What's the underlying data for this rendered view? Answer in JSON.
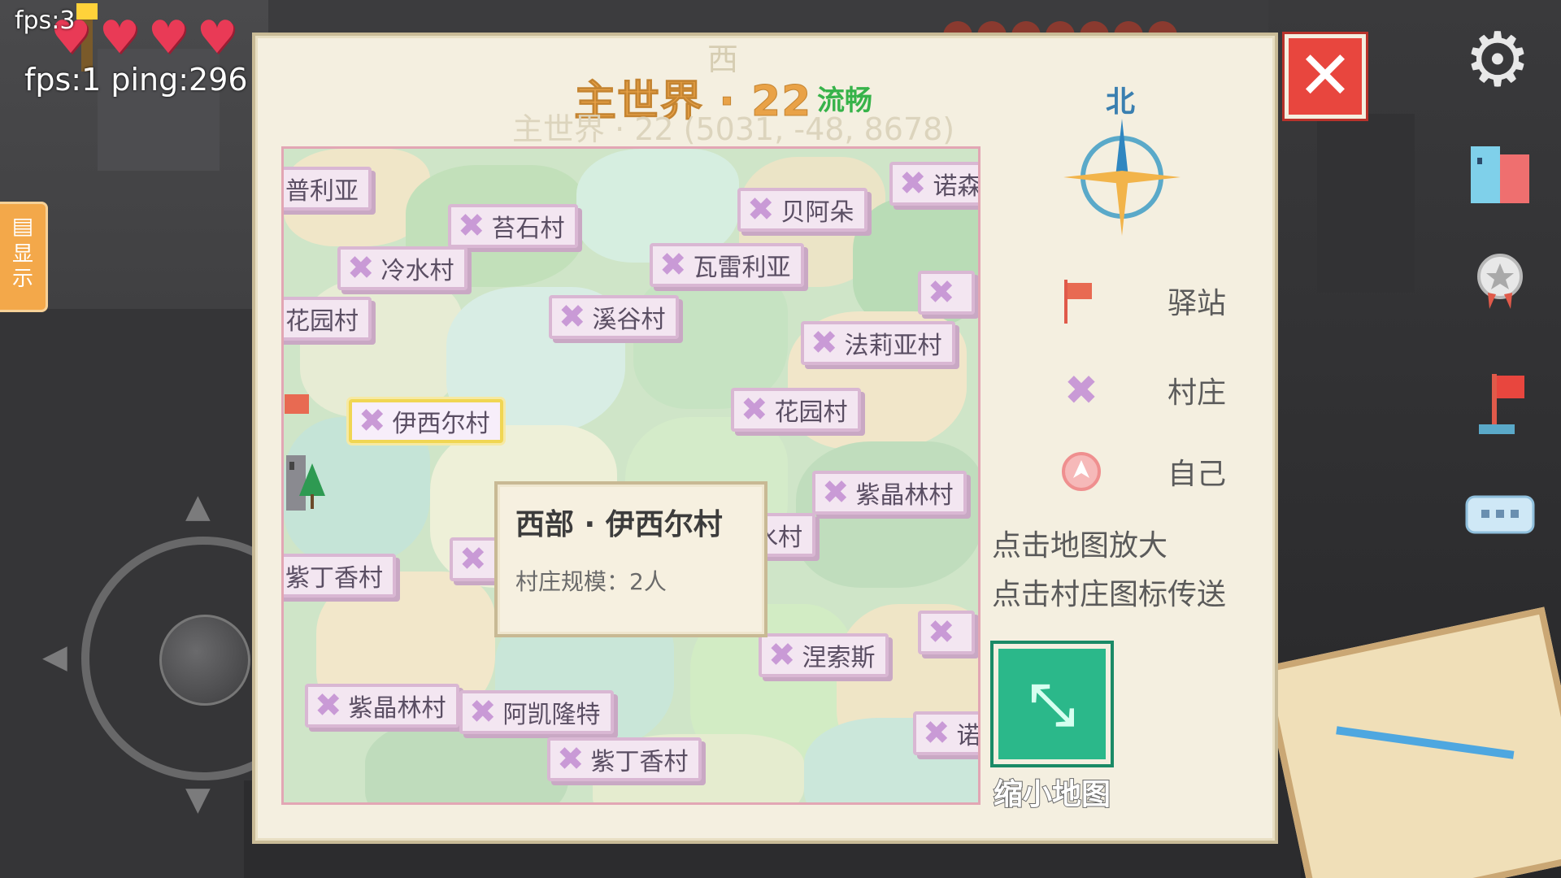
{
  "hud": {
    "fps_top": "fps:3",
    "fps_ping": "fps:1 ping:296",
    "hearts": [
      "♥",
      "♥",
      "♥",
      "♥"
    ],
    "show_tab": {
      "icon": "chat-bubble-icon",
      "label": "显示"
    }
  },
  "panel": {
    "west_label": "西",
    "title": "主世界 · 22",
    "status": "流畅",
    "subtitle": "主世界 · 22  (5031, -48, 8678)",
    "north_label": "北",
    "close_icon": "✕"
  },
  "map": {
    "villages": [
      {
        "label": "普利亚"
      },
      {
        "label": "苔石村"
      },
      {
        "label": "贝阿朵"
      },
      {
        "label": "诺森"
      },
      {
        "label": "冷水村"
      },
      {
        "label": "瓦雷利亚"
      },
      {
        "label": "花园村"
      },
      {
        "label": "溪谷村"
      },
      {
        "label": "法莉亚村"
      },
      {
        "label": "伊西尔村"
      },
      {
        "label": "花园村"
      },
      {
        "label": "紫晶林村"
      },
      {
        "label": "冷水村"
      },
      {
        "label": "紫丁香村"
      },
      {
        "label": "涅索斯"
      },
      {
        "label": "紫晶林村"
      },
      {
        "label": "阿凯隆特"
      },
      {
        "label": "紫丁香村"
      },
      {
        "label": "诺"
      }
    ],
    "tooltip": {
      "title": "西部 · 伊西尔村",
      "scale": "村庄规模：2人"
    }
  },
  "legend": [
    {
      "icon": "flag-icon",
      "label": "驿站"
    },
    {
      "icon": "village-icon",
      "label": "村庄"
    },
    {
      "icon": "self-arrow-icon",
      "label": "自己"
    }
  ],
  "hints": [
    "点击地图放大",
    "点击村庄图标传送"
  ],
  "shrink": {
    "label": "缩小地图"
  },
  "colors": {
    "accent": "#e9a247",
    "close": "#e8463e",
    "shrink": "#2bb88a",
    "status": "#37b34a"
  }
}
